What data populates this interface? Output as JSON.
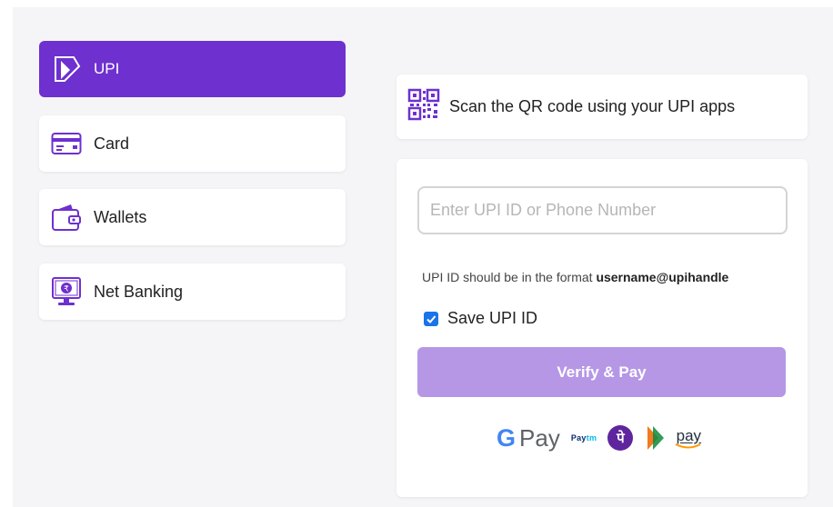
{
  "methods": [
    {
      "id": "upi",
      "label": "UPI",
      "icon": "upi-icon",
      "active": true
    },
    {
      "id": "card",
      "label": "Card",
      "icon": "card-icon",
      "active": false
    },
    {
      "id": "wallets",
      "label": "Wallets",
      "icon": "wallet-icon",
      "active": false
    },
    {
      "id": "netbanking",
      "label": "Net Banking",
      "icon": "net-banking-icon",
      "active": false
    }
  ],
  "qr": {
    "label": "Scan the QR code using your UPI apps",
    "icon": "qr-code-icon"
  },
  "form": {
    "input_value": "",
    "input_placeholder": "Enter UPI ID or Phone Number",
    "hint_prefix": "UPI ID should be in the format ",
    "hint_format": "username@upihandle",
    "save_label": "Save UPI ID",
    "save_checked": true,
    "verify_label": "Verify & Pay"
  },
  "apps": {
    "gpay_g": "G",
    "gpay_label": "Pay",
    "paytm_label": "Pay",
    "paytm_tm": "tm",
    "phonepe_label": "पे",
    "amazonpay_label": "pay"
  },
  "colors": {
    "accent": "#6e30cf",
    "button_disabled": "#b597e6",
    "checkbox": "#1a73e8"
  }
}
